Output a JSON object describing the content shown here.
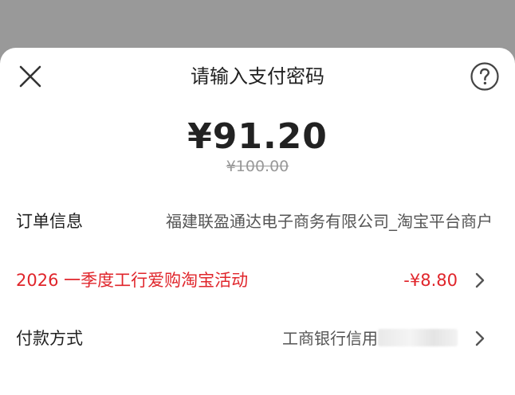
{
  "header": {
    "title": "请输入支付密码",
    "close_icon": "close-icon",
    "help_icon": "help-icon"
  },
  "payment": {
    "amount": "¥91.20",
    "original_amount": "¥100.00"
  },
  "order_info": {
    "label": "订单信息",
    "value": "福建联盈通达电子商务有限公司_淘宝平台商户"
  },
  "promotion": {
    "label": "2026 一季度工行爱购淘宝活动",
    "value": "-¥8.80"
  },
  "payment_method": {
    "label": "付款方式",
    "value": "工商银行信用"
  },
  "colors": {
    "accent_red": "#e0252b",
    "backdrop": "#999999"
  }
}
